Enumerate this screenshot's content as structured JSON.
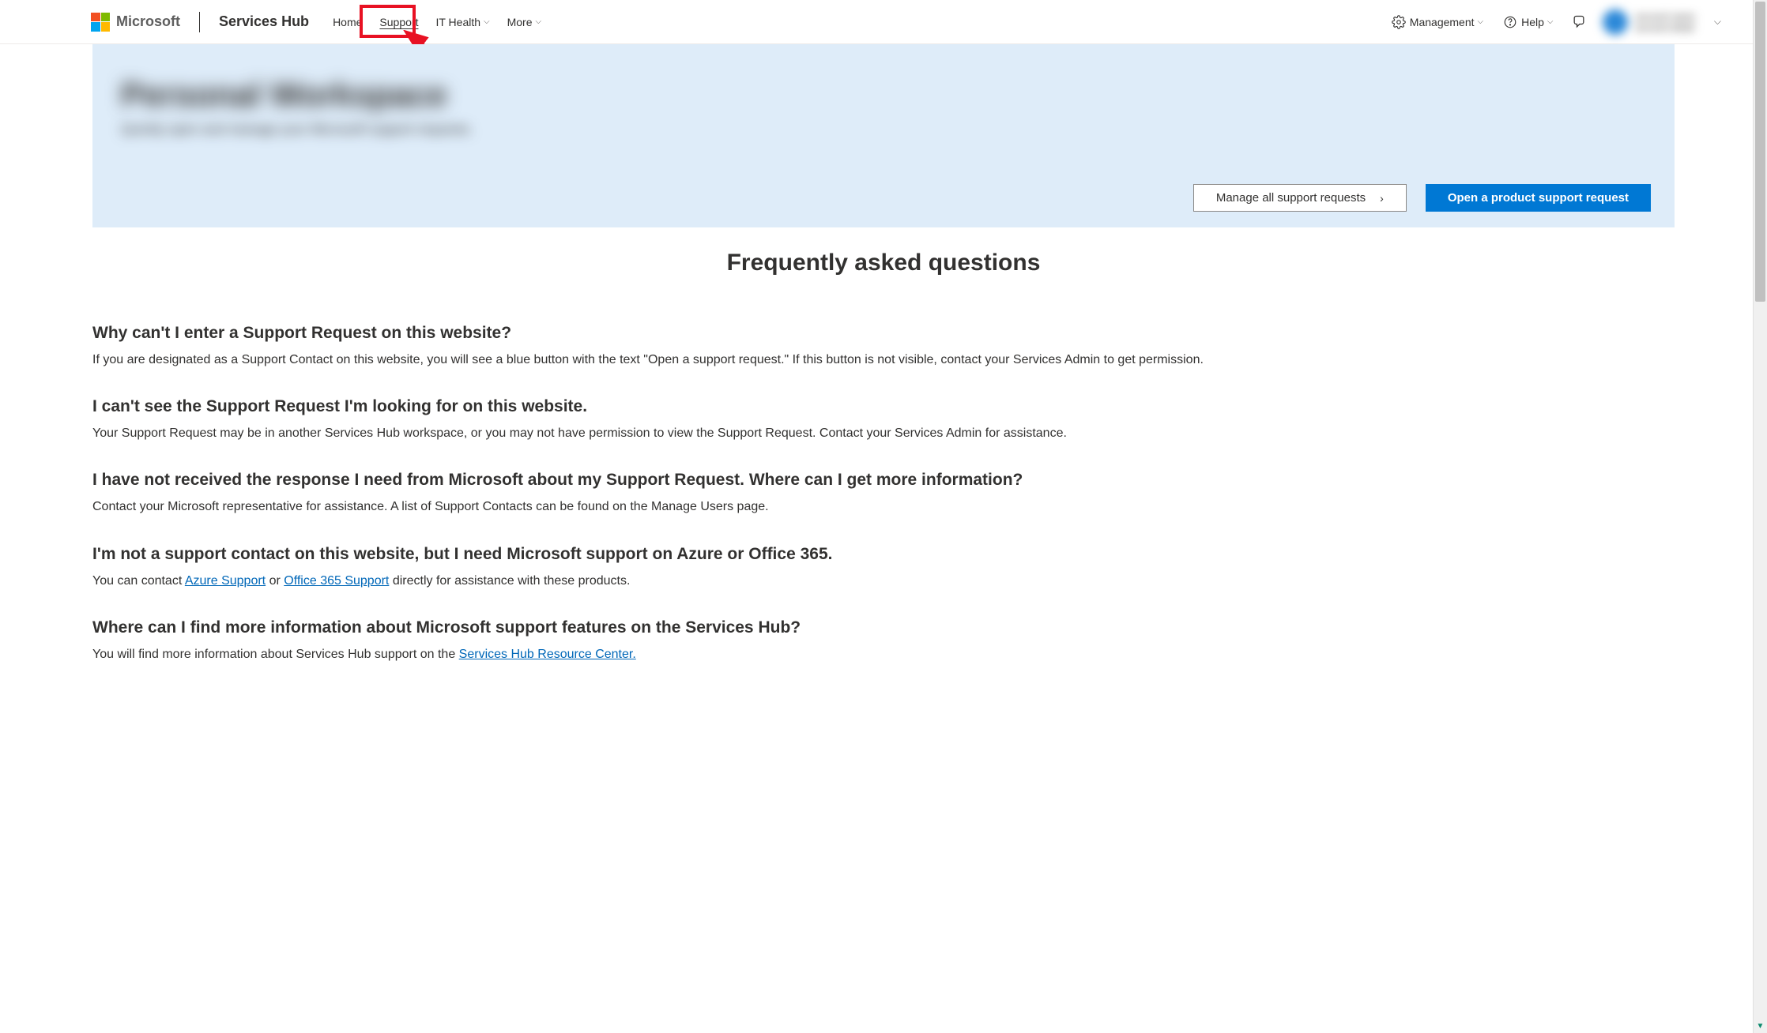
{
  "header": {
    "microsoft": "Microsoft",
    "brand": "Services Hub",
    "nav": {
      "home": "Home",
      "support": "Support",
      "it_health": "IT Health",
      "more": "More",
      "management": "Management",
      "help": "Help"
    },
    "user": {
      "line1": "account name",
      "line2": "account detail"
    }
  },
  "hero": {
    "title": "Personal Workspace",
    "subtitle": "Quickly open and manage your Microsoft support requests.",
    "manage_btn": "Manage all support requests",
    "open_btn": "Open a product support request"
  },
  "faq": {
    "heading": "Frequently asked questions",
    "items": [
      {
        "q": "Why can't I enter a Support Request on this website?",
        "a_pre": "If you are designated as a Support Contact on this website, you will see a blue button with the text \"Open a support request.\" If this button is not visible, contact your Services Admin to get permission."
      },
      {
        "q": "I can't see the Support Request I'm looking for on this website.",
        "a_pre": "Your Support Request may be in another Services Hub workspace, or you may not have permission to view the Support Request. Contact your Services Admin for assistance."
      },
      {
        "q": "I have not received the response I need from Microsoft about my Support Request. Where can I get more information?",
        "a_pre": "Contact your Microsoft representative for assistance. A list of Support Contacts can be found on the Manage Users page."
      },
      {
        "q": "I'm not a support contact on this website, but I need Microsoft support on Azure or Office 365.",
        "a_pre": "You can contact ",
        "link1": "Azure Support",
        "a_mid": " or ",
        "link2": "Office 365 Support",
        "a_post": " directly for assistance with these products."
      },
      {
        "q": "Where can I find more information about Microsoft support features on the Services Hub?",
        "a_pre": "You will find more information about Services Hub support on the ",
        "link1": "Services Hub Resource Center."
      }
    ]
  }
}
